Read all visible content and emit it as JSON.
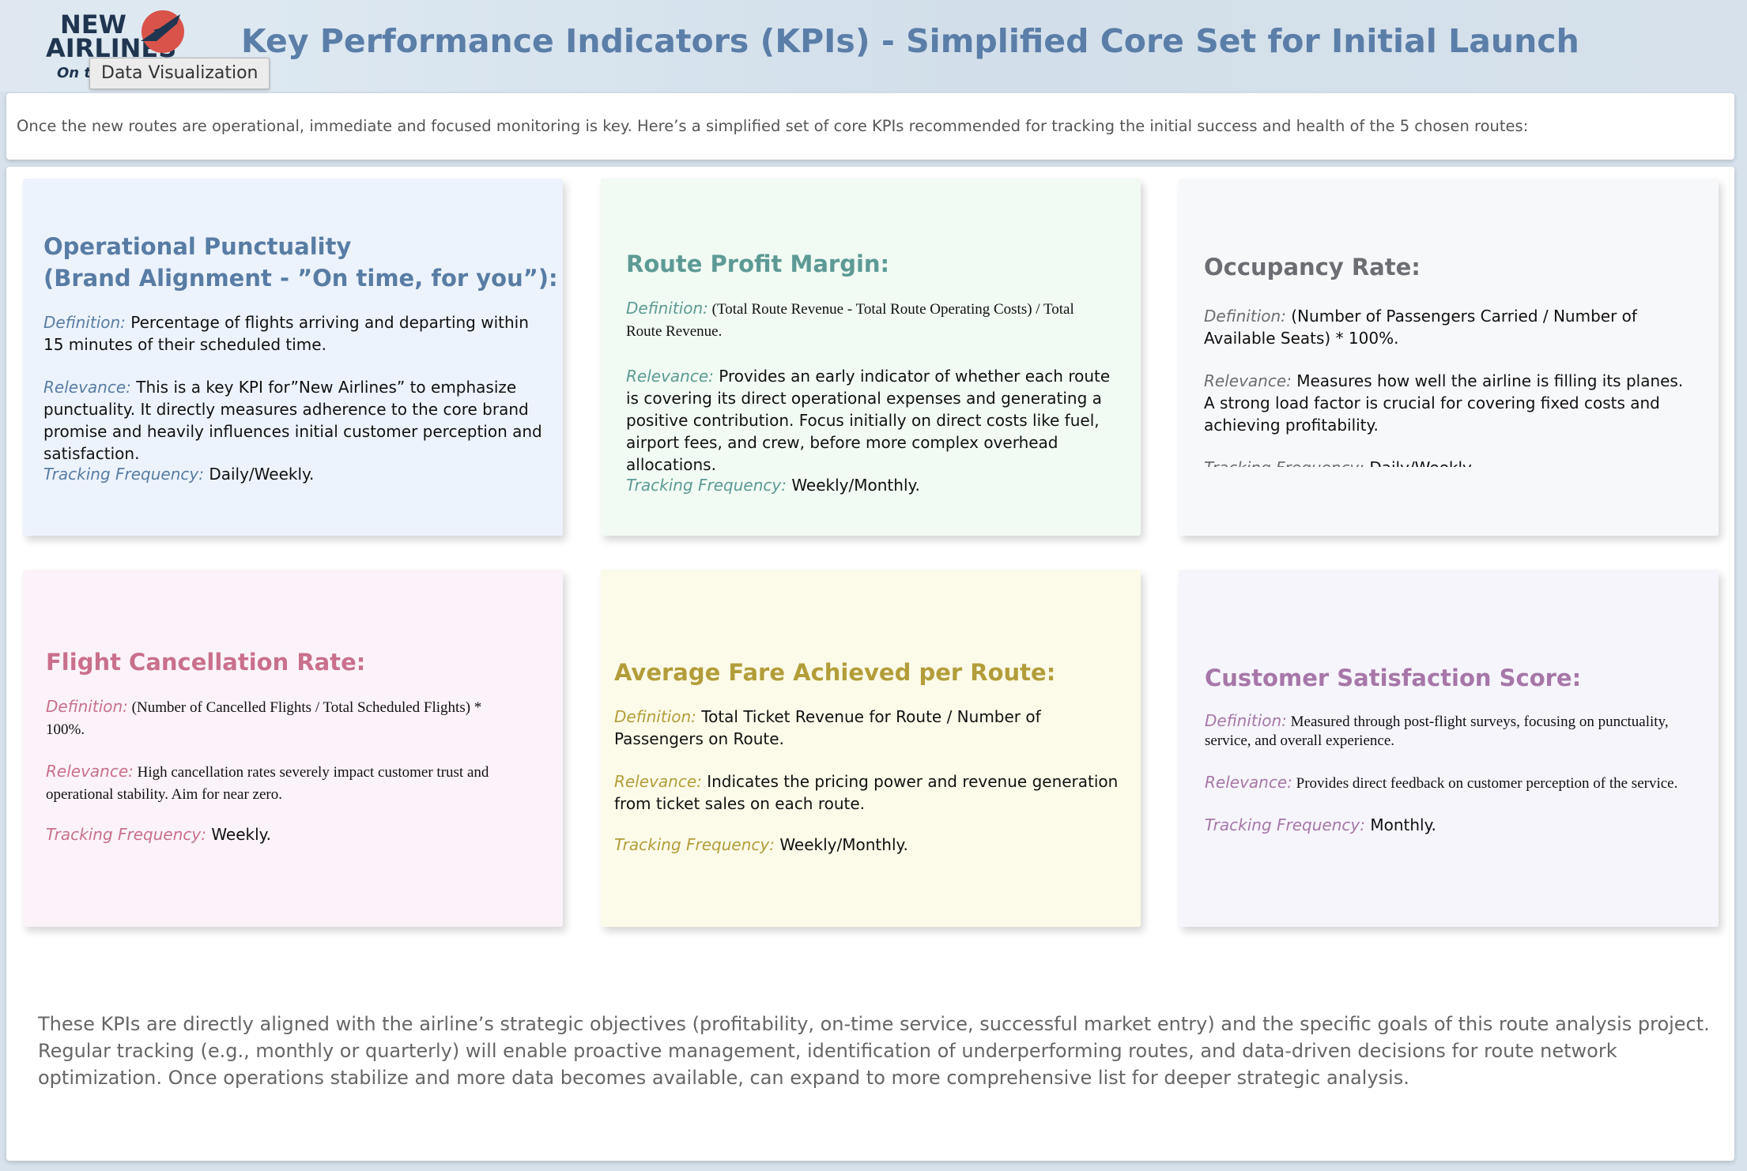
{
  "header": {
    "logo_line1": "NEW",
    "logo_line2": "AIRLINES",
    "logo_tagline": "On ti",
    "tooltip": "Data Visualization",
    "title": "Key Performance Indicators (KPIs) - Simplified Core Set for Initial Launch"
  },
  "intro": "Once the new routes are operational, immediate and focused monitoring is key. Here’s a simplified set of core KPIs recommended for tracking the initial success and health of the 5 chosen routes:",
  "labels": {
    "definition": "Definition:",
    "relevance": "Relevance:",
    "tracking": "Tracking Frequency:"
  },
  "cards": [
    {
      "title_line1": "Operational Punctuality",
      "title_line2": "(Brand Alignment - ”On time, for you”):",
      "definition": "Percentage of flights arriving and departing within 15 minutes of their scheduled time.",
      "relevance": "This is a key KPI for”New Airlines” to emphasize punctuality. It directly measures adherence to the core brand promise and heavily influences initial customer perception and satisfaction.",
      "tracking": "Daily/Weekly.",
      "bg": "#edf3fc",
      "accent": "#587ca4"
    },
    {
      "title": "Route Profit Margin:",
      "definition": "(Total Route Revenue - Total Route Operating Costs) / Total Route Revenue.",
      "relevance": "Provides an early indicator of whether each route is covering its direct operational expenses and generating a positive contribution. Focus initially on direct costs like fuel, airport fees, and crew, before more complex overhead allocations.",
      "tracking": "Weekly/Monthly.",
      "bg": "#f1faf3",
      "accent": "#5d9a95"
    },
    {
      "title": "Occupancy Rate:",
      "definition": "(Number of Passengers Carried / Number of Available Seats) * 100%.",
      "relevance": "Measures how well the airline is filling its planes. A strong load factor is crucial for covering fixed costs and achieving profitability.",
      "tracking": "Daily/Weekly",
      "bg": "#f7f8fa",
      "accent": "#6b6e72"
    },
    {
      "title": "Flight Cancellation Rate:",
      "definition": "(Number of Cancelled Flights / Total Scheduled Flights) * 100%.",
      "relevance": "High cancellation rates severely impact customer trust and operational stability. Aim for near zero.",
      "tracking": "Weekly.",
      "bg": "#fbf3f9",
      "accent": "#c9708c"
    },
    {
      "title": "Average Fare Achieved per Route:",
      "definition": "Total Ticket Revenue for Route / Number of Passengers on Route.",
      "relevance": "Indicates the pricing power and revenue generation from ticket sales on each route.",
      "tracking": "Weekly/Monthly.",
      "bg": "#fcfbe9",
      "accent": "#b29d3a"
    },
    {
      "title": "Customer Satisfaction Score:",
      "definition": "Measured through post-flight surveys, focusing on punctuality, service, and overall experience.",
      "relevance": "Provides direct feedback on customer perception of the service.",
      "tracking": "Monthly.",
      "bg": "#f6f5fc",
      "accent": "#a677a8"
    }
  ],
  "conclusion": "These KPIs are directly aligned with the airline’s strategic objectives (profitability, on-time service, successful market entry) and the specific goals of this route analysis project. Regular tracking (e.g., monthly or quarterly) will enable proactive management, identification of underperforming routes, and data-driven decisions for route network optimization. Once operations stabilize and more data becomes available, can expand to more comprehensive list for deeper strategic analysis."
}
